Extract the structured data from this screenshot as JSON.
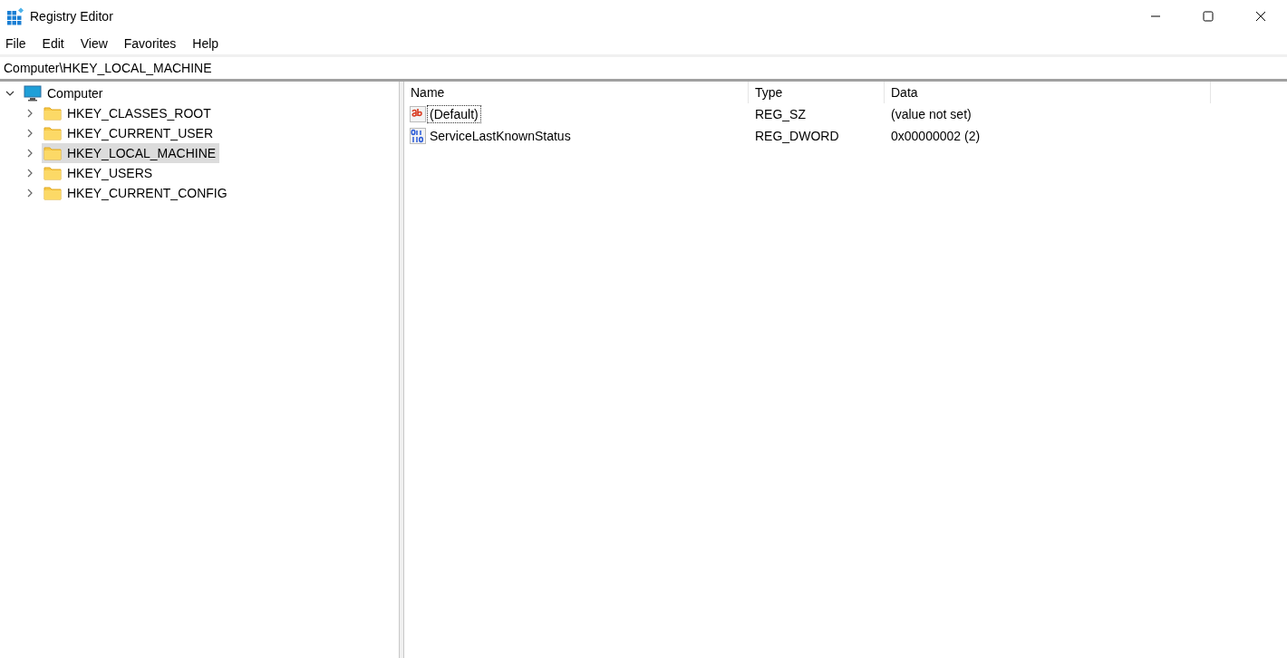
{
  "window": {
    "title": "Registry Editor"
  },
  "menu": [
    "File",
    "Edit",
    "View",
    "Favorites",
    "Help"
  ],
  "address": "Computer\\HKEY_LOCAL_MACHINE",
  "tree": [
    {
      "label": "Computer",
      "kind": "computer",
      "expanded": true,
      "selected": false,
      "children": [
        {
          "label": "HKEY_CLASSES_ROOT",
          "kind": "folder",
          "expanded": false,
          "selected": false
        },
        {
          "label": "HKEY_CURRENT_USER",
          "kind": "folder",
          "expanded": false,
          "selected": false
        },
        {
          "label": "HKEY_LOCAL_MACHINE",
          "kind": "folder",
          "expanded": false,
          "selected": true
        },
        {
          "label": "HKEY_USERS",
          "kind": "folder",
          "expanded": false,
          "selected": false
        },
        {
          "label": "HKEY_CURRENT_CONFIG",
          "kind": "folder",
          "expanded": false,
          "selected": false
        }
      ]
    }
  ],
  "table": {
    "columns": [
      "Name",
      "Type",
      "Data"
    ],
    "rows": [
      {
        "kind": "string",
        "name": "(Default)",
        "type": "REG_SZ",
        "data": "(value not set)",
        "focused": true
      },
      {
        "kind": "dword",
        "name": "ServiceLastKnownStatus",
        "type": "REG_DWORD",
        "data": "0x00000002 (2)",
        "focused": false
      }
    ]
  }
}
